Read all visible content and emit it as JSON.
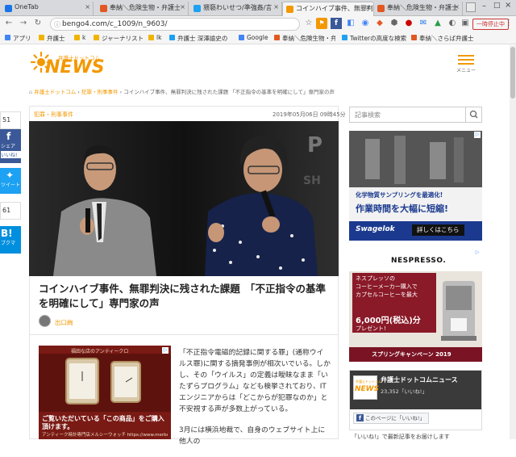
{
  "browser": {
    "tabs": [
      {
        "label": "OneTab",
        "color": "#1a73e8"
      },
      {
        "label": "奉納＼危険生物・弁護士",
        "color": "#e25822"
      },
      {
        "label": "猥褻わいせつ/準強姦/言",
        "color": "#1da1f2"
      },
      {
        "label": "コインハイブ事件、無罪判",
        "color": "#f39800"
      },
      {
        "label": "奉納＼危険生物・弁護士",
        "color": "#e25822"
      }
    ],
    "url": "bengo4.com/c_1009/n_9603/",
    "sleep_button": "一時停止中",
    "bookmarks": [
      {
        "label": "アプリ",
        "color": "#4285f4"
      },
      {
        "label": "弁護士",
        "color": "#f0b400"
      },
      {
        "label": "k",
        "color": "#f0b400"
      },
      {
        "label": "ジャーナリスト",
        "color": "#f0b400"
      },
      {
        "label": "lk",
        "color": "#f0b400"
      },
      {
        "label": "弁護士 深澤諭史の",
        "color": "#1da1f2"
      },
      {
        "label": "Google",
        "color": "#4285f4"
      },
      {
        "label": "奉納＼危険生物・弁護",
        "color": "#e25822"
      },
      {
        "label": "Twitterの高度な検索",
        "color": "#1da1f2"
      },
      {
        "label": "奉納＼さらば弁護士",
        "color": "#e25822"
      }
    ]
  },
  "site": {
    "logo_sub": "弁護士ドットコム",
    "logo_main": "NEWS",
    "menu_label": "メニュー",
    "breadcrumb": {
      "home": "弁護士ドットコム",
      "sep": "›",
      "category": "犯罪・刑事事件",
      "current": "コインハイブ事件、無罪判決に残された課題 「不正指令の基準を明確にして」専門家の声"
    }
  },
  "share": [
    {
      "count": "51"
    },
    {
      "label": "シェア",
      "sub": "いいね!",
      "color": "#3b5998"
    },
    {
      "label": "ツイート",
      "color": "#1da1f2"
    },
    {
      "count": "61"
    },
    {
      "label": "B!",
      "sub": "ブクマ",
      "color": "#008fde"
    }
  ],
  "article": {
    "category": "犯罪・刑事事件",
    "date": "2019年05月06日 09時45分",
    "title": "コインハイブ事件、無罪判決に残された課題　「不正指令の基準を明確にして」専門家の声",
    "author": "出口絢",
    "paragraphs": [
      "「不正指令電磁的記録に関する罪」(通称ウイルス罪)に関する摘発事例が相次いでいる。しかし、その「ウイルス」の定義は曖昧なまま「いたずらプログラム」なども検挙されており、ITエンジニアからは「どこからが犯罪なのか」と不安視する声が多数上がっている。",
      "3月には横浜地裁で、自身のウェブサイト上に他人の"
    ],
    "ad": {
      "top": "福田な店のアンティークロ",
      "main": "ご覧いただいている「この商品」をご購入頂けます。",
      "sub": "アンティーク時計専門店メルシーウォッチ https://www.merbop.com/"
    }
  },
  "sidebar": {
    "search_placeholder": "記事検索",
    "ad1": {
      "line1": "化学物質サンプリングを最適化!",
      "line2": "作業時間を大幅に短縮!",
      "brand": "Swagelok",
      "cta": "詳しくはこちら"
    },
    "ad2": {
      "brand": "NESPRESSO.",
      "line1": "ネスプレッソの",
      "line2": "コーヒーメーカー購入で",
      "line3": "カプセルコーヒーを最大",
      "price": "6,000円(税込)分",
      "line4": "プレゼント!",
      "campaign": "スプリングキャンペーン 2019"
    },
    "fb": {
      "logo_sub": "弁護士ドットコム",
      "logo": "NEWS",
      "name": "弁護士ドットコムニュース",
      "likes": "23,352「いいね!」",
      "like_btn": "このページに「いいね!」"
    },
    "caption": "「いいね!」で最新記事をお届けします"
  }
}
